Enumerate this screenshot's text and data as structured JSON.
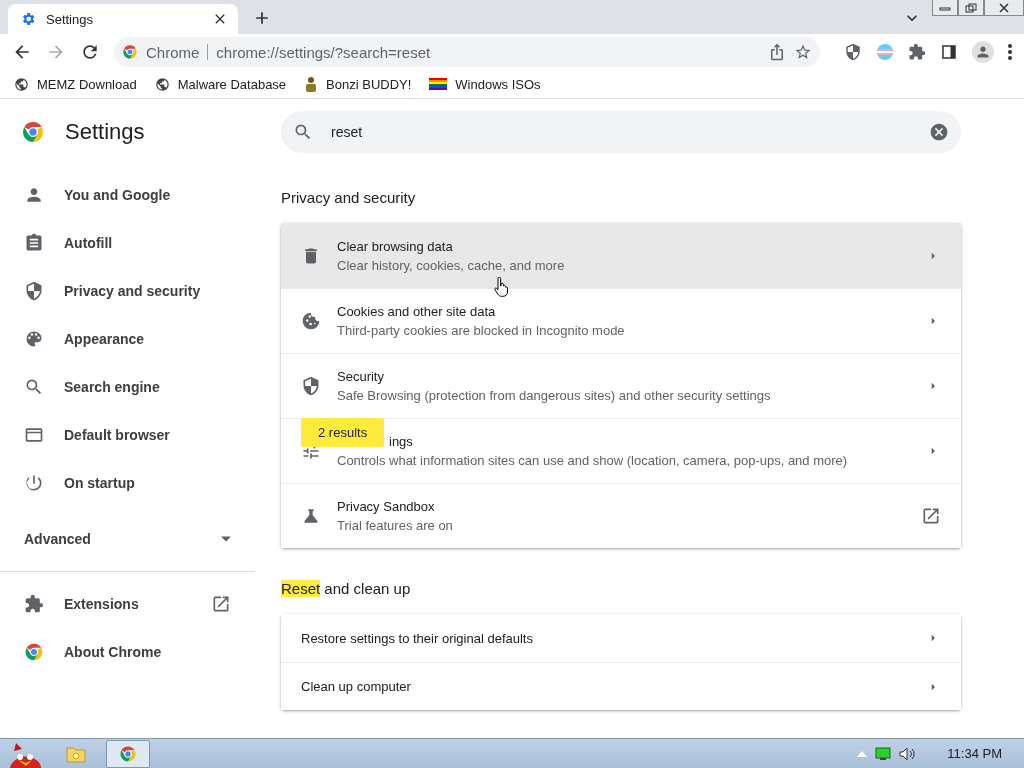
{
  "tabs": [
    {
      "title": "Settings",
      "selected": true
    }
  ],
  "address": {
    "chip": "Chrome",
    "url": "chrome://settings/?search=reset"
  },
  "bookmarks": [
    {
      "label": "MEMZ Download"
    },
    {
      "label": "Malware Database"
    },
    {
      "label": "Bonzi BUDDY!"
    },
    {
      "label": "Windows ISOs"
    }
  ],
  "sidebar": {
    "title": "Settings",
    "items": [
      {
        "label": "You and Google"
      },
      {
        "label": "Autofill"
      },
      {
        "label": "Privacy and security"
      },
      {
        "label": "Appearance"
      },
      {
        "label": "Search engine"
      },
      {
        "label": "Default browser"
      },
      {
        "label": "On startup"
      }
    ],
    "advanced": {
      "label": "Advanced",
      "expanded": false
    },
    "footer_items": [
      {
        "label": "Extensions",
        "kind": "external"
      },
      {
        "label": "About Chrome",
        "kind": "internal"
      }
    ]
  },
  "search": {
    "value": "reset"
  },
  "sections": [
    {
      "heading": [
        {
          "text": "Privacy and security",
          "highlighted": false
        }
      ],
      "rows": [
        {
          "title": "Clear browsing data",
          "subtitle": "Clear history, cookies, cache, and more",
          "kind": "arrow",
          "hovered": true
        },
        {
          "title": "Cookies and other site data",
          "subtitle": "Third-party cookies are blocked in Incognito mode",
          "kind": "arrow",
          "hovered": false
        },
        {
          "title": "Security",
          "subtitle": "Safe Browsing (protection from dangerous sites) and other security settings",
          "kind": "arrow",
          "hovered": false
        },
        {
          "title": "ings",
          "subtitle": "Controls what information sites can use and show (location, camera, pop-ups, and more)",
          "kind": "arrow",
          "hovered": false,
          "bubble": "2 results"
        },
        {
          "title": "Privacy Sandbox",
          "subtitle": "Trial features are on",
          "kind": "external",
          "hovered": false
        }
      ]
    },
    {
      "heading": [
        {
          "text": "Reset",
          "highlighted": true
        },
        {
          "text": " and clean up",
          "highlighted": false
        }
      ],
      "rows": [
        {
          "title": "Restore settings to their original defaults",
          "kind": "arrow",
          "hovered": false
        },
        {
          "title": "Clean up computer",
          "kind": "arrow",
          "hovered": false
        }
      ]
    }
  ],
  "taskbar": {
    "apps": [
      {
        "kind": "folder",
        "selected": false
      },
      {
        "kind": "chrome",
        "selected": true
      }
    ],
    "clock": "11:34 PM"
  }
}
